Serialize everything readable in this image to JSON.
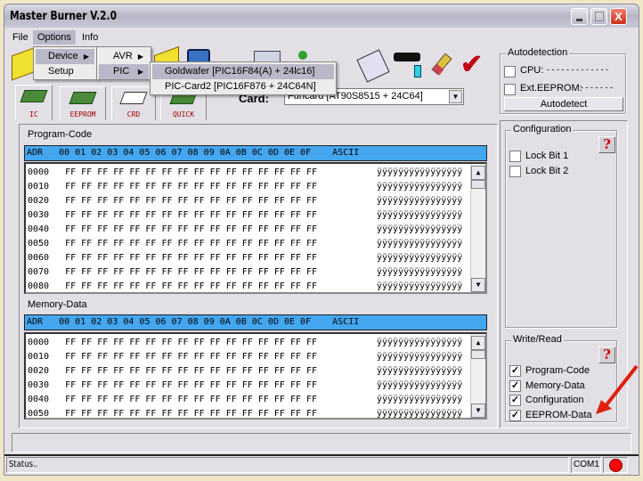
{
  "window": {
    "title": "Master Burner V.2.0",
    "close": "X"
  },
  "menu": {
    "items": [
      "File",
      "Options",
      "Info"
    ],
    "options": [
      "Device",
      "Setup"
    ],
    "device": [
      "AVR",
      "PIC"
    ],
    "pic": [
      "Goldwafer [PIC16F84(A) + 24lc16]",
      "PIC-Card2 [PIC16F876 + 24C64N]"
    ]
  },
  "tabs": [
    "IC",
    "EEPROM",
    "CRD",
    "QUICK"
  ],
  "card": {
    "label": "Card:",
    "value": "Funcard [AT90S8515 + 24C64]"
  },
  "autodetection": {
    "title": "Autodetection",
    "cpu": "CPU:",
    "cpu_value": "- - - - - - - - - - - - -",
    "ext": "Ext.EEPROM:",
    "ext_value": "- - - - - - -",
    "button": "Autodetect"
  },
  "configuration": {
    "title": "Configuration",
    "help": "?",
    "items": [
      {
        "label": "Lock Bit 1",
        "checked": false
      },
      {
        "label": "Lock Bit 2",
        "checked": false
      }
    ]
  },
  "write_read": {
    "title": "Write/Read",
    "help": "?",
    "items": [
      {
        "label": "Program-Code",
        "checked": true
      },
      {
        "label": "Memory-Data",
        "checked": true
      },
      {
        "label": "Configuration",
        "checked": true
      },
      {
        "label": "EEPROM-Data",
        "checked": true
      }
    ]
  },
  "program_code": {
    "title": "Program-Code",
    "header": "ADR   00 01 02 03 04 05 06 07 08 09 0A 0B 0C 0D 0E 0F    ASCII",
    "rows": [
      {
        "adr": "0000",
        "bytes": "FF FF FF FF FF FF FF FF FF FF FF FF FF FF FF FF",
        "ascii": "ÿÿÿÿÿÿÿÿÿÿÿÿÿÿÿÿ"
      },
      {
        "adr": "0010",
        "bytes": "FF FF FF FF FF FF FF FF FF FF FF FF FF FF FF FF",
        "ascii": "ÿÿÿÿÿÿÿÿÿÿÿÿÿÿÿÿ"
      },
      {
        "adr": "0020",
        "bytes": "FF FF FF FF FF FF FF FF FF FF FF FF FF FF FF FF",
        "ascii": "ÿÿÿÿÿÿÿÿÿÿÿÿÿÿÿÿ"
      },
      {
        "adr": "0030",
        "bytes": "FF FF FF FF FF FF FF FF FF FF FF FF FF FF FF FF",
        "ascii": "ÿÿÿÿÿÿÿÿÿÿÿÿÿÿÿÿ"
      },
      {
        "adr": "0040",
        "bytes": "FF FF FF FF FF FF FF FF FF FF FF FF FF FF FF FF",
        "ascii": "ÿÿÿÿÿÿÿÿÿÿÿÿÿÿÿÿ"
      },
      {
        "adr": "0050",
        "bytes": "FF FF FF FF FF FF FF FF FF FF FF FF FF FF FF FF",
        "ascii": "ÿÿÿÿÿÿÿÿÿÿÿÿÿÿÿÿ"
      },
      {
        "adr": "0060",
        "bytes": "FF FF FF FF FF FF FF FF FF FF FF FF FF FF FF FF",
        "ascii": "ÿÿÿÿÿÿÿÿÿÿÿÿÿÿÿÿ"
      },
      {
        "adr": "0070",
        "bytes": "FF FF FF FF FF FF FF FF FF FF FF FF FF FF FF FF",
        "ascii": "ÿÿÿÿÿÿÿÿÿÿÿÿÿÿÿÿ"
      },
      {
        "adr": "0080",
        "bytes": "FF FF FF FF FF FF FF FF FF FF FF FF FF FF FF FF",
        "ascii": "ÿÿÿÿÿÿÿÿÿÿÿÿÿÿÿÿ"
      }
    ]
  },
  "memory_data": {
    "title": "Memory-Data",
    "header": "ADR   00 01 02 03 04 05 06 07 08 09 0A 0B 0C 0D 0E 0F    ASCII",
    "rows": [
      {
        "adr": "0000",
        "bytes": "FF FF FF FF FF FF FF FF FF FF FF FF FF FF FF FF",
        "ascii": "ÿÿÿÿÿÿÿÿÿÿÿÿÿÿÿÿ"
      },
      {
        "adr": "0010",
        "bytes": "FF FF FF FF FF FF FF FF FF FF FF FF FF FF FF FF",
        "ascii": "ÿÿÿÿÿÿÿÿÿÿÿÿÿÿÿÿ"
      },
      {
        "adr": "0020",
        "bytes": "FF FF FF FF FF FF FF FF FF FF FF FF FF FF FF FF",
        "ascii": "ÿÿÿÿÿÿÿÿÿÿÿÿÿÿÿÿ"
      },
      {
        "adr": "0030",
        "bytes": "FF FF FF FF FF FF FF FF FF FF FF FF FF FF FF FF",
        "ascii": "ÿÿÿÿÿÿÿÿÿÿÿÿÿÿÿÿ"
      },
      {
        "adr": "0040",
        "bytes": "FF FF FF FF FF FF FF FF FF FF FF FF FF FF FF FF",
        "ascii": "ÿÿÿÿÿÿÿÿÿÿÿÿÿÿÿÿ"
      },
      {
        "adr": "0050",
        "bytes": "FF FF FF FF FF FF FF FF FF FF FF FF FF FF FF FF",
        "ascii": "ÿÿÿÿÿÿÿÿÿÿÿÿÿÿÿÿ"
      }
    ]
  },
  "status": {
    "text": "Status..",
    "port": "COM1",
    "led_color": "#ff0000"
  },
  "colors": {
    "hex_header": "#44a6ef",
    "annotation_arrow": "#e02010"
  }
}
